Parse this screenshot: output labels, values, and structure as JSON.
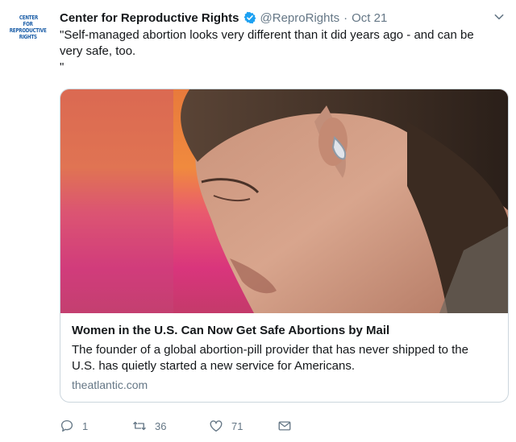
{
  "tweet": {
    "author_name": "Center for Reproductive Rights",
    "handle": "@ReproRights",
    "separator": "·",
    "timestamp": "Oct 21",
    "text_line1": "\"Self-managed abortion looks very different than it did years ago - and can be",
    "text_line2": "very safe, too.",
    "text_line3": "\""
  },
  "avatar": {
    "lines": [
      "CENTER",
      "FOR",
      "REPRODUCTIVE",
      "RIGHTS"
    ]
  },
  "card": {
    "title": "Women in the U.S. Can Now Get Safe Abortions by Mail",
    "description_line1": "The founder of a global abortion-pill provider that has never shipped to the",
    "description_line2": "U.S. has quietly started a new service for Americans.",
    "domain": "theatlantic.com"
  },
  "actions": {
    "replies": "1",
    "retweets": "36",
    "likes": "71"
  },
  "colors": {
    "verified": "#1da1f2",
    "muted": "#657786",
    "border": "#ccd6dd",
    "avatar_text": "#1d5fa8"
  },
  "icons": [
    "verified-badge-icon",
    "caret-down-icon",
    "reply-icon",
    "retweet-icon",
    "like-icon",
    "direct-message-icon"
  ]
}
